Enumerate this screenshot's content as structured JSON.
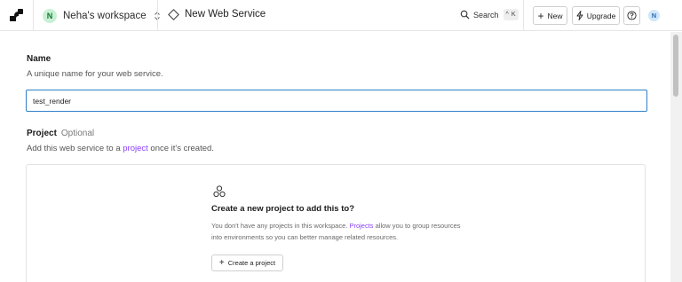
{
  "topbar": {
    "workspace": {
      "avatar_letter": "N",
      "name": "Neha's workspace"
    },
    "service_title": "New Web Service",
    "search": {
      "label": "Search",
      "shortcut_mod": "^",
      "shortcut_key": "K"
    },
    "new_label": "New",
    "upgrade_label": "Upgrade",
    "user_avatar": "N"
  },
  "form": {
    "name": {
      "label": "Name",
      "description": "A unique name for your web service.",
      "value": "test_render"
    },
    "project": {
      "label": "Project",
      "optional": "Optional",
      "desc_before": "Add this web service to a",
      "desc_link": "project",
      "desc_after": "once it's created."
    }
  },
  "project_card": {
    "heading": "Create a new project to add this to?",
    "text_before": "You don't have any projects in this workspace.",
    "text_link": "Projects",
    "text_after": "allow you to group resources into environments so you can better manage related resources.",
    "button_label": "Create a project"
  },
  "colors": {
    "accent": "#8a3ffc",
    "input_focus": "#2f80c7",
    "workspace_avatar_bg": "#c8f1d3"
  }
}
